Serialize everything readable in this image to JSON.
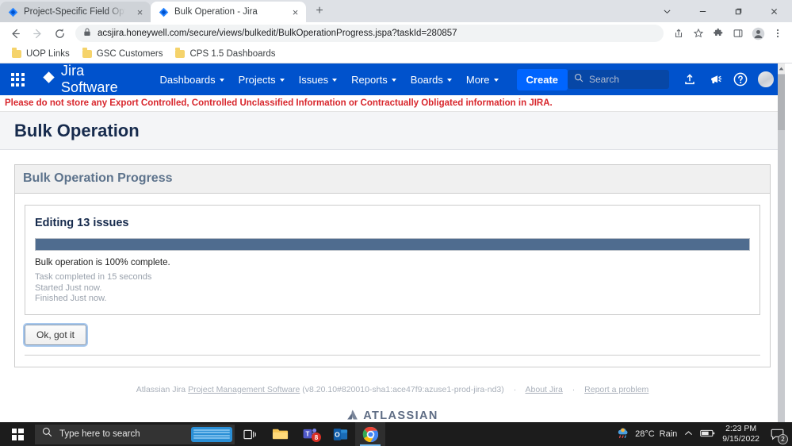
{
  "browser": {
    "tabs": [
      {
        "title": "Project-Specific Field Options - Ji",
        "favicon": "jira-icon",
        "active": false,
        "close": "×"
      },
      {
        "title": "Bulk Operation - Jira",
        "favicon": "jira-icon",
        "active": true,
        "close": "×"
      }
    ],
    "new_tab_label": "+",
    "window_controls": {
      "minimize": "−",
      "restore": "❐",
      "close": "✕",
      "chevron": "∨"
    },
    "nav": {
      "back": "←",
      "forward": "→",
      "reload": "⟳"
    },
    "omnibox": {
      "url": "acsjira.honeywell.com/secure/views/bulkedit/BulkOperationProgress.jspa?taskId=280857",
      "lock_icon": "lock-icon"
    },
    "toolbar_icons": [
      "share-icon",
      "bookmark-star-icon",
      "extensions-puzzle-icon",
      "side-panel-icon",
      "profile-icon",
      "kebab-menu-icon"
    ],
    "bookmarks": [
      {
        "label": "UOP Links"
      },
      {
        "label": "GSC Customers"
      },
      {
        "label": "CPS 1.5 Dashboards"
      }
    ]
  },
  "jira": {
    "app_switcher": "app-switcher-icon",
    "logo_text": "Jira Software",
    "nav_items": [
      {
        "label": "Dashboards",
        "has_caret": true
      },
      {
        "label": "Projects",
        "has_caret": true
      },
      {
        "label": "Issues",
        "has_caret": true
      },
      {
        "label": "Reports",
        "has_caret": true
      },
      {
        "label": "Boards",
        "has_caret": true
      },
      {
        "label": "More",
        "has_caret": true
      }
    ],
    "create_label": "Create",
    "search_placeholder": "Search",
    "right_icons": [
      "upload-icon",
      "announcement-megaphone-icon",
      "help-icon",
      "avatar"
    ]
  },
  "banner": {
    "text": "Please do not store any Export Controlled, Controlled Unclassified Information or Contractually Obligated information in JIRA."
  },
  "page": {
    "title": "Bulk Operation",
    "panel_heading": "Bulk Operation Progress",
    "progress": {
      "heading": "Editing 13 issues",
      "percent": 100,
      "status": "Bulk operation is 100% complete.",
      "completed": "Task completed in 15 seconds",
      "started": "Started Just now.",
      "finished": "Finished Just now.",
      "bar_color": "#4f6c8f"
    },
    "ok_button": "Ok, got it"
  },
  "footer": {
    "prefix": "Atlassian Jira",
    "product_link": "Project Management Software",
    "version": "(v8.20.10#820010-sha1:ace47f9:azuse1-prod-jira-nd3)",
    "about_link": "About Jira",
    "report_link": "Report a problem",
    "separator": "·",
    "brand": "ATLASSIAN"
  },
  "taskbar": {
    "search_placeholder": "Type here to search",
    "icons": [
      {
        "name": "task-view-icon"
      },
      {
        "name": "file-explorer-icon"
      },
      {
        "name": "microsoft-teams-icon",
        "badge": "8"
      },
      {
        "name": "outlook-icon"
      },
      {
        "name": "google-chrome-icon"
      }
    ],
    "tray": {
      "weather_temp": "28°C",
      "weather_cond": "Rain",
      "chevron": "⌃",
      "time": "2:23 PM",
      "date": "9/15/2022",
      "notification_count": "2"
    }
  }
}
